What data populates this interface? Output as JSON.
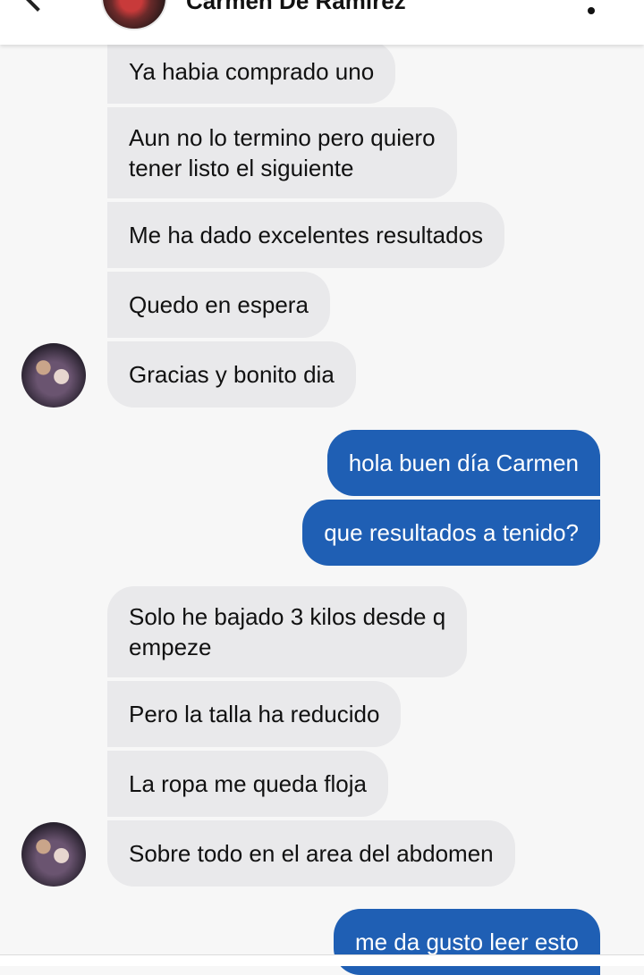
{
  "header": {
    "contact_name": "Carmen De Ramirez",
    "back_icon": "chevron-left-icon",
    "more_icon": "more-vertical-icon"
  },
  "colors": {
    "incoming_bubble": "#e9e9eb",
    "outgoing_bubble": "#1f5fb4",
    "background": "#f7f7f7"
  },
  "messages": [
    {
      "from": "contact",
      "text": "Ya habia comprado uno"
    },
    {
      "from": "contact",
      "text": "Aun no lo termino pero quiero\ntener listo el siguiente"
    },
    {
      "from": "contact",
      "text": "Me ha dado excelentes resultados"
    },
    {
      "from": "contact",
      "text": "Quedo en espera"
    },
    {
      "from": "contact",
      "text": "Gracias y bonito dia"
    },
    {
      "from": "me",
      "text": "hola buen día Carmen"
    },
    {
      "from": "me",
      "text": "que resultados a tenido?"
    },
    {
      "from": "contact",
      "text": "Solo he bajado 3 kilos desde q\nempeze"
    },
    {
      "from": "contact",
      "text": "Pero la talla ha reducido"
    },
    {
      "from": "contact",
      "text": "La ropa me queda floja"
    },
    {
      "from": "contact",
      "text": "Sobre todo en el area del abdomen"
    },
    {
      "from": "me",
      "text": "me da gusto leer esto"
    }
  ]
}
